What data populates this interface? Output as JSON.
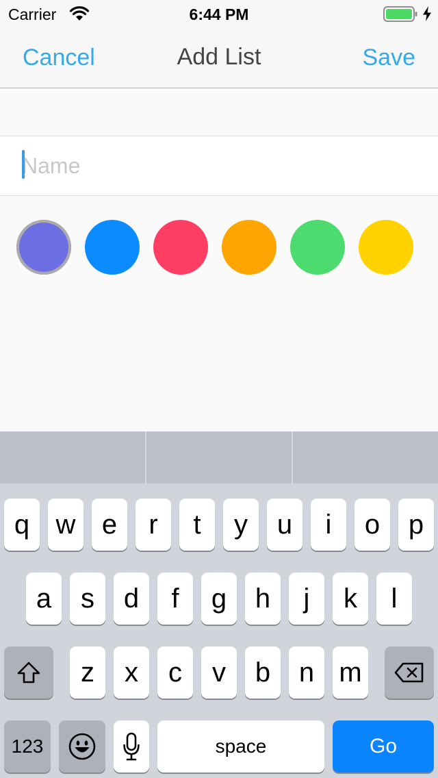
{
  "status_bar": {
    "carrier": "Carrier",
    "time": "6:44 PM",
    "battery_color": "#4cd964"
  },
  "nav": {
    "cancel_label": "Cancel",
    "title": "Add List",
    "save_label": "Save"
  },
  "name_field": {
    "placeholder": "Name",
    "value": ""
  },
  "colors": [
    {
      "name": "purple",
      "hex": "#6b6fe1",
      "selected": true
    },
    {
      "name": "blue",
      "hex": "#0a8cff",
      "selected": false
    },
    {
      "name": "red",
      "hex": "#ff3e64",
      "selected": false
    },
    {
      "name": "orange",
      "hex": "#ffa500",
      "selected": false
    },
    {
      "name": "green",
      "hex": "#4cdb6e",
      "selected": false
    },
    {
      "name": "yellow",
      "hex": "#ffd200",
      "selected": false
    }
  ],
  "keyboard": {
    "row1": [
      "q",
      "w",
      "e",
      "r",
      "t",
      "y",
      "u",
      "i",
      "o",
      "p"
    ],
    "row2": [
      "a",
      "s",
      "d",
      "f",
      "g",
      "h",
      "j",
      "k",
      "l"
    ],
    "row3": [
      "z",
      "x",
      "c",
      "v",
      "b",
      "n",
      "m"
    ],
    "numbers_label": "123",
    "space_label": "space",
    "go_label": "Go",
    "shift_icon": "shift-icon",
    "delete_icon": "delete-icon",
    "emoji_icon": "emoji-icon",
    "mic_icon": "microphone-icon"
  }
}
